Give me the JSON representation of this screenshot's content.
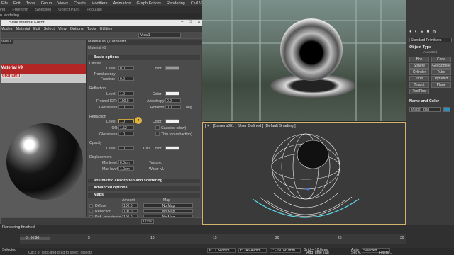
{
  "menubar": [
    "File",
    "Edit",
    "Tools",
    "Group",
    "Views",
    "Create",
    "Modifiers",
    "Animation",
    "Graph Editors",
    "Rendering",
    "Civil View",
    "Customize",
    "Scripting",
    "Content",
    "Help"
  ],
  "ribbon": [
    "ing",
    "Freeform",
    "Selection",
    "Object Paint",
    "Populate"
  ],
  "ribbon_hint": "n Modeling",
  "sme": {
    "title": "Slate Material Editor",
    "menu": [
      "Modes",
      "Material",
      "Edit",
      "Select",
      "View",
      "Options",
      "Tools",
      "Utilities"
    ],
    "view_select": "View1",
    "view_tab": "View1",
    "node_line1": "Material #9",
    "node_line2": "oronaMtl",
    "panel_header": "Material #9 ( CoronaMtl )",
    "panel_sub": "Material #9",
    "basic_options": "Basic options",
    "diffuse": {
      "label": "Diffuse",
      "level_label": "Level:",
      "level": "0.0",
      "color_label": "Color:"
    },
    "translucency": {
      "label": "Translucency",
      "fraction_label": "Fraction:",
      "fraction": "0.0"
    },
    "reflection": {
      "label": "Reflection",
      "level_label": "Level:",
      "level": "1.0",
      "color_label": "Color:",
      "fresnel_label": "Fresnel IOR:",
      "fresnel": "100.0",
      "aniso_label": "Anisotropy:",
      "aniso": "0.0",
      "gloss_label": "Glossiness:",
      "gloss": "1.0",
      "rotation_label": "Rotation:",
      "rotation": "0.0",
      "deg": "deg."
    },
    "refraction": {
      "label": "Refraction",
      "level_label": "Level:",
      "level": "1.0",
      "color_label": "Color:",
      "ior_label": "IOR:",
      "ior": "1.52",
      "gloss_label": "Glossiness:",
      "gloss": "1.0",
      "caustics": "Caustics (slow)",
      "thin": "Thin (no refraction)"
    },
    "opacity": {
      "label": "Opacity",
      "level_label": "Level:",
      "level": "1.0",
      "clip": "Clip",
      "color_label": "Color:"
    },
    "displacement": {
      "label": "Displacement",
      "min_label": "Min level:",
      "min": "0.0cm",
      "max_label": "Max level:",
      "max": "1.0cm",
      "texture_label": "Texture:",
      "water_label": "Water lvl.:"
    },
    "vol_section": "Volumetric absorption and scattering",
    "adv_section": "Advanced options",
    "maps_section": "Maps",
    "maps_cols": {
      "amount": "Amount",
      "map": "Map"
    },
    "maps_rows": [
      {
        "name": "Diffuse",
        "amount": "100.0",
        "map": "No Map"
      },
      {
        "name": "Reflection",
        "amount": "100.0",
        "map": "No Map"
      },
      {
        "name": "Refl. glossiness",
        "amount": "100.0",
        "map": "No Map"
      }
    ],
    "zoom": "121%"
  },
  "viewport_bottom_label": "[ + ] [Camera001 ] [User Defined ] [Default Shading ]",
  "cmd": {
    "std_prim": "Standard Primitives",
    "object_type": "Object Type",
    "autogrid": "AutoGrid",
    "buttons": [
      "Box",
      "Cone",
      "Sphere",
      "GeoSphere",
      "Cylinder",
      "Tube",
      "Torus",
      "Pyramid",
      "Teapot",
      "Plane",
      "TextPlus"
    ],
    "name_color": "Name and Color",
    "name": "shader_ball"
  },
  "status": {
    "render": "Rendering finished",
    "frame": "0 / 30",
    "ticks": [
      "0",
      "5",
      "10",
      "15",
      "20",
      "25",
      "30"
    ],
    "selected": "Selected",
    "hint": "Click or click-and-drag to select objects",
    "x": "X: 11.848mm",
    "y": "Y: 246.49mm",
    "z": "Z: -150.667mm",
    "grid": "Grid = 10.0mm",
    "add_time_tag": "Add Time Tag",
    "auto": "Auto",
    "set_k": "Set K.",
    "sel_dropdown": "Selected",
    "filters": "Filters..."
  }
}
